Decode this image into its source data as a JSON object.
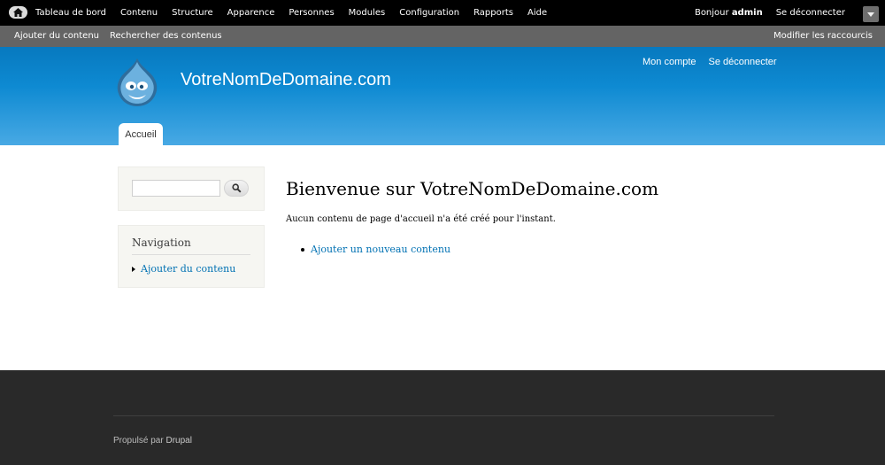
{
  "admin_toolbar": {
    "home_icon": "home-icon",
    "menu": [
      "Tableau de bord",
      "Contenu",
      "Structure",
      "Apparence",
      "Personnes",
      "Modules",
      "Configuration",
      "Rapports",
      "Aide"
    ],
    "greeting": "Bonjour",
    "username": "admin",
    "logout": "Se déconnecter"
  },
  "shortcuts": {
    "items": [
      "Ajouter du contenu",
      "Rechercher des contenus"
    ],
    "edit": "Modifier les raccourcis"
  },
  "header": {
    "site_name": "VotreNomDeDomaine.com",
    "secondary_menu": [
      "Mon compte",
      "Se déconnecter"
    ],
    "tab": "Accueil",
    "logo_icon": "drupal-drop-logo"
  },
  "sidebar": {
    "search_value": "",
    "search_icon": "search-icon",
    "navigation_title": "Navigation",
    "navigation_items": [
      "Ajouter du contenu"
    ]
  },
  "main": {
    "title": "Bienvenue sur VotreNomDeDomaine.com",
    "intro": "Aucun contenu de page d'accueil n'a été créé pour l'instant.",
    "links": [
      "Ajouter un nouveau contenu"
    ]
  },
  "footer": {
    "prefix": "Propulsé par",
    "link": "Drupal"
  },
  "colors": {
    "header_blue": "#0779bf",
    "link_blue": "#0071b3",
    "footer_bg": "#292929"
  }
}
